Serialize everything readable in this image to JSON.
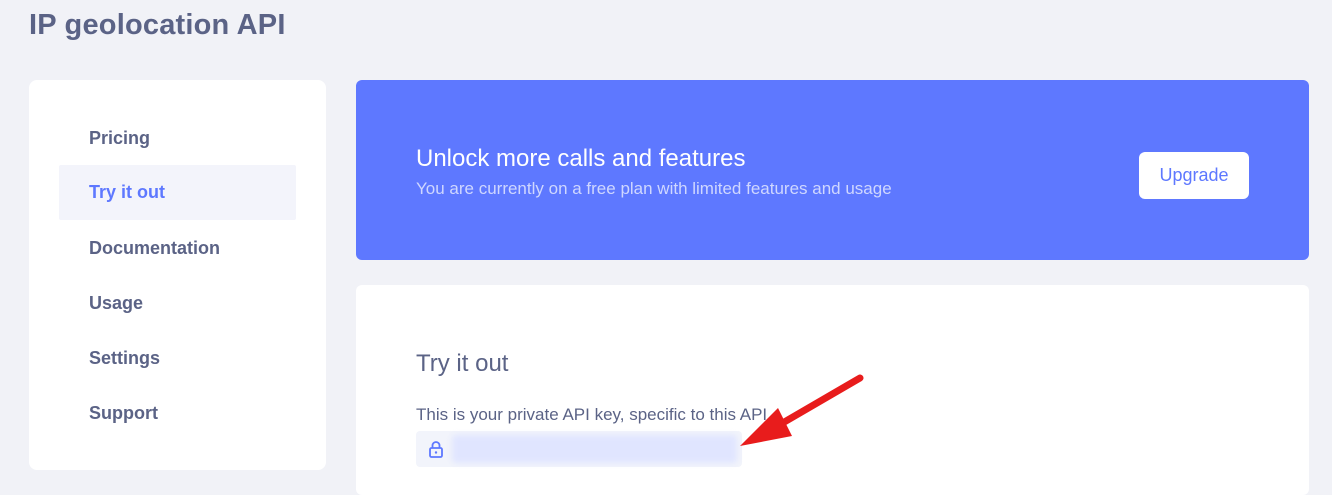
{
  "header": {
    "title": "IP geolocation API"
  },
  "sidebar": {
    "items": [
      {
        "label": "Pricing",
        "active": false
      },
      {
        "label": "Try it out",
        "active": true
      },
      {
        "label": "Documentation",
        "active": false
      },
      {
        "label": "Usage",
        "active": false
      },
      {
        "label": "Settings",
        "active": false
      },
      {
        "label": "Support",
        "active": false
      }
    ]
  },
  "banner": {
    "title": "Unlock more calls and features",
    "subtitle": "You are currently on a free plan with limited features and usage",
    "upgrade_label": "Upgrade"
  },
  "main": {
    "title": "Try it out",
    "api_key_description": "This is your private API key, specific to this API",
    "api_key_icon": "lock-icon"
  },
  "colors": {
    "accent": "#5e78ff",
    "text": "#5b6386",
    "background": "#f1f2f7",
    "arrow": "#e81c1c"
  }
}
